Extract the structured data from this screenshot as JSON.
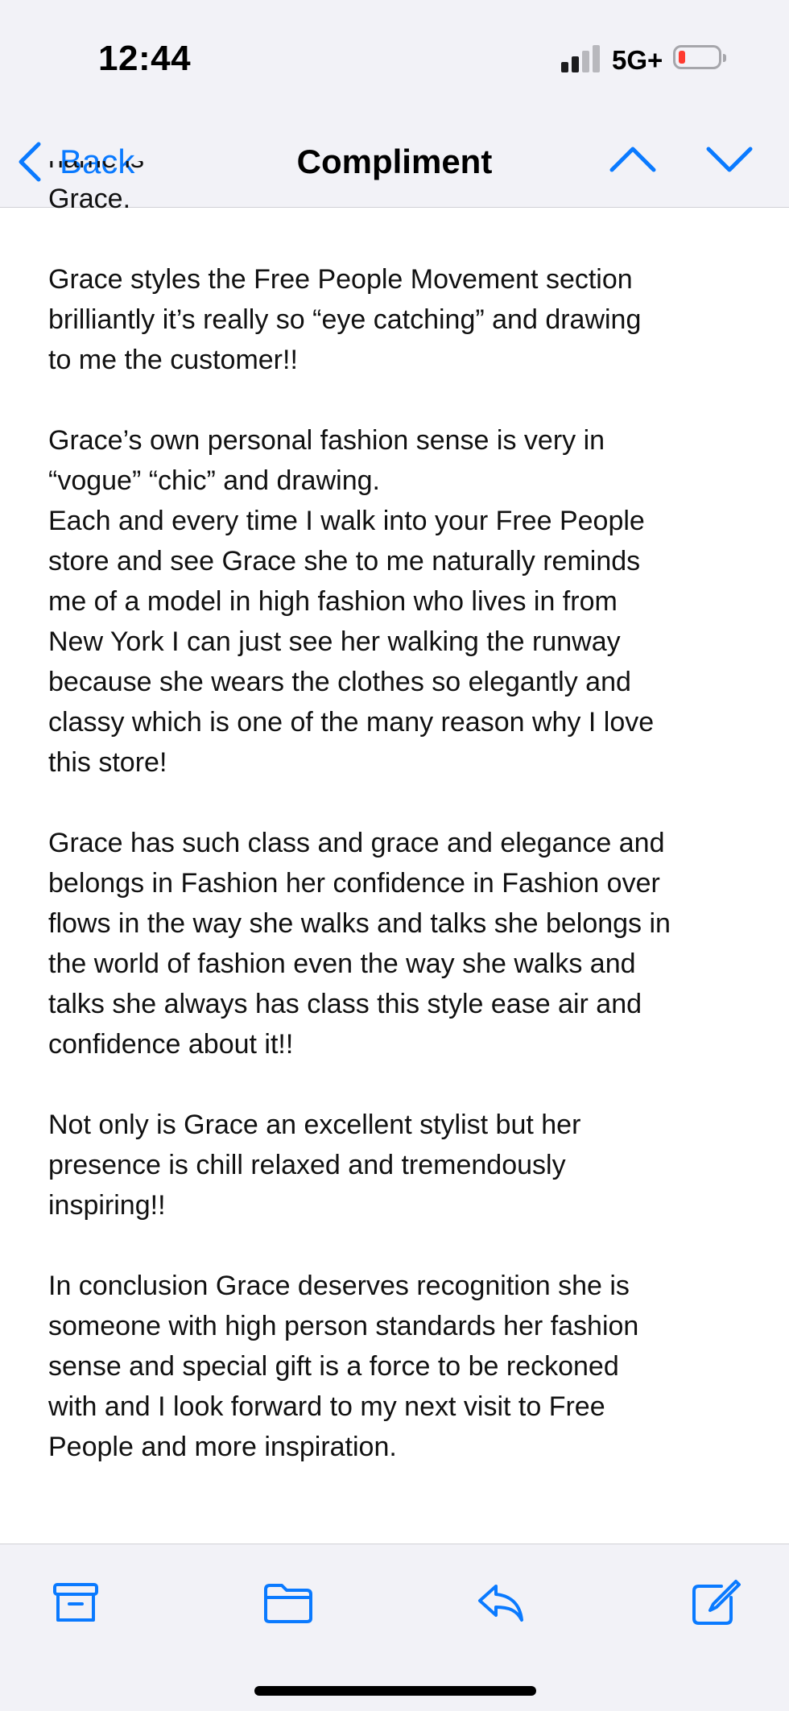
{
  "status_bar": {
    "time": "12:44",
    "network": "5G+",
    "battery_level": 0.15,
    "battery_color": "#ff3b30"
  },
  "nav": {
    "back_label": "Back",
    "title": "Compliment",
    "up_icon": "chevron-up-icon",
    "down_icon": "chevron-down-icon"
  },
  "message": {
    "clipped_line": "name is",
    "paragraphs": [
      [
        "Grace."
      ],
      [
        "Grace styles the Free People Movement section",
        "brilliantly it’s really  so “eye catching” and drawing",
        "to me the  customer!!"
      ],
      [
        "Grace’s own personal fashion sense is very in",
        "“vogue” “chic” and drawing.",
        "Each and every time I walk into your Free People",
        "store and see Grace she to me naturally reminds",
        "me of a model in high fashion who lives in from",
        "New York I can just see her walking the runway",
        "because she wears the clothes so elegantly and",
        "classy which is one of the many reason why I love",
        "this store!"
      ],
      [
        "Grace  has such class and grace and elegance and",
        "belongs in Fashion her confidence in Fashion over",
        "flows in the way she walks and talks she belongs in",
        "the world of fashion even the way she walks and",
        "talks she always has class this style ease air and",
        "confidence about it!!"
      ],
      [
        " Not only is Grace an excellent stylist but her",
        "presence is chill relaxed and tremendously",
        "inspiring!!"
      ],
      [
        "In conclusion Grace deserves recognition she is",
        "someone with high person standards her fashion",
        "sense and special gift is a force to be reckoned",
        "with and I look forward to my next visit to Free",
        "People and more inspiration."
      ]
    ]
  },
  "toolbar": {
    "icons": [
      "archive-icon",
      "folder-icon",
      "reply-icon",
      "compose-icon"
    ],
    "accent_color": "#0a7aff"
  }
}
